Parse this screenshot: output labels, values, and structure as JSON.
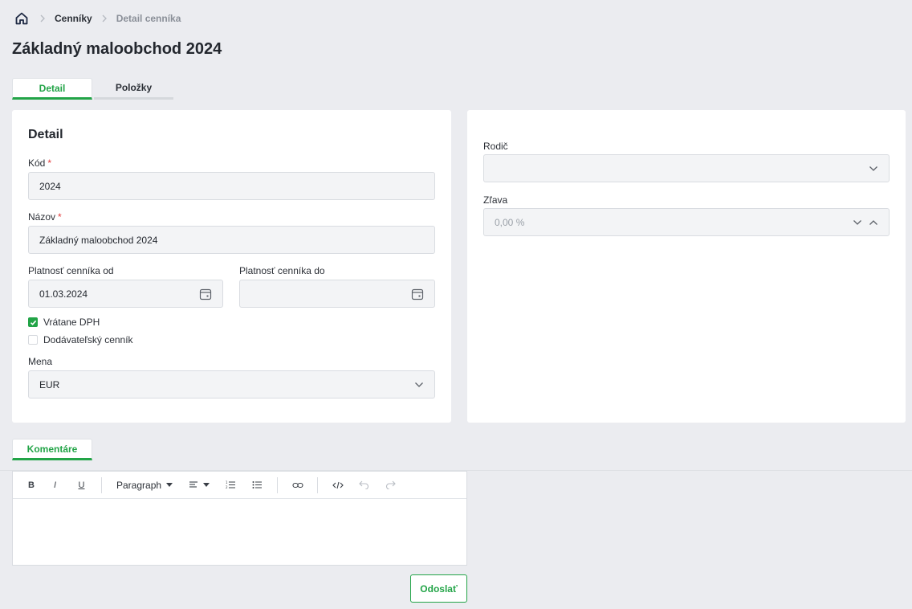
{
  "breadcrumb": {
    "home_icon": "home-icon",
    "items": [
      "Cenníky",
      "Detail cenníka"
    ]
  },
  "page_title": "Základný maloobchod 2024",
  "tabs": [
    {
      "label": "Detail",
      "active": true
    },
    {
      "label": "Položky",
      "active": false
    }
  ],
  "detail": {
    "section_title": "Detail",
    "code": {
      "label": "Kód",
      "required_mark": "*",
      "value": "2024"
    },
    "name": {
      "label": "Názov",
      "required_mark": "*",
      "value": "Základný maloobchod 2024"
    },
    "valid_from": {
      "label": "Platnosť cenníka od",
      "value": "01.03.2024"
    },
    "valid_to": {
      "label": "Platnosť cenníka do",
      "value": ""
    },
    "incl_vat": {
      "label": "Vrátane DPH",
      "checked": true
    },
    "supplier": {
      "label": "Dodávateľský cenník",
      "checked": false
    },
    "currency": {
      "label": "Mena",
      "value": "EUR"
    }
  },
  "side": {
    "parent": {
      "label": "Rodič",
      "value": ""
    },
    "discount": {
      "label": "Zľava",
      "value": "0,00 %"
    }
  },
  "comments": {
    "tab_label": "Komentáre",
    "toolbar": {
      "bold": "B",
      "italic": "I",
      "underline": "U",
      "block_format": "Paragraph"
    },
    "submit_label": "Odoslať"
  },
  "colors": {
    "accent": "#22a447",
    "required": "#e23b3b",
    "background": "#ebecf0"
  }
}
